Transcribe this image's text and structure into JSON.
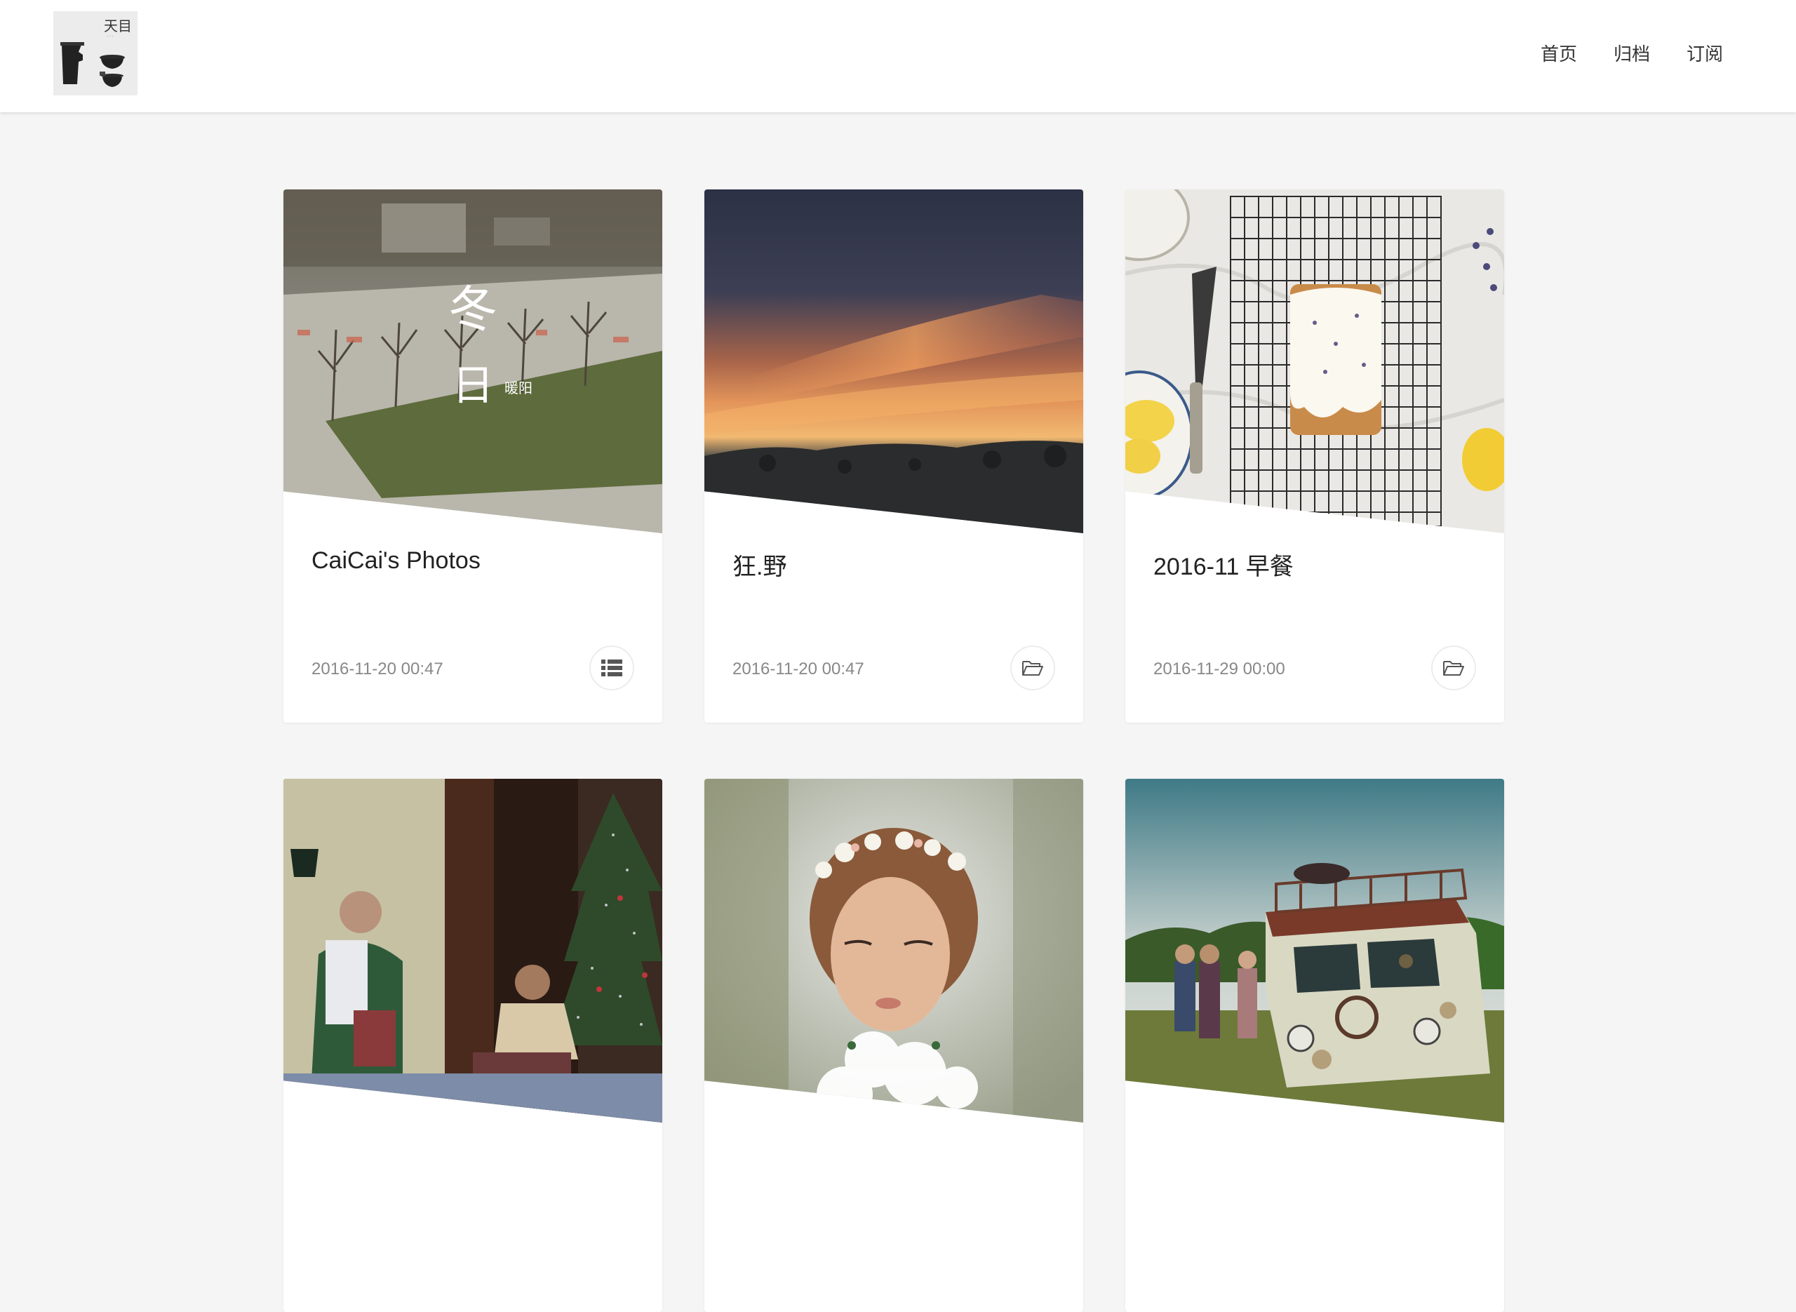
{
  "header": {
    "logo_alt": "天目",
    "nav": [
      "首页",
      "归档",
      "订阅"
    ]
  },
  "posts": [
    {
      "title": "CaiCai's Photos",
      "date": "2016-11-20 00:47",
      "type_icon": "list-icon",
      "cover_text": [
        "冬",
        "日",
        "暖阳"
      ]
    },
    {
      "title": "狂.野",
      "date": "2016-11-20 00:47",
      "type_icon": "folder-open-icon"
    },
    {
      "title": "2016-11 早餐",
      "date": "2016-11-29 00:00",
      "type_icon": "folder-open-icon"
    },
    {
      "title": "",
      "date": "",
      "type_icon": ""
    },
    {
      "title": "",
      "date": "",
      "type_icon": ""
    },
    {
      "title": "",
      "date": "",
      "type_icon": ""
    }
  ],
  "colors": {
    "background": "#f5f5f5",
    "card": "#ffffff",
    "title": "#222222",
    "meta": "#888888"
  }
}
